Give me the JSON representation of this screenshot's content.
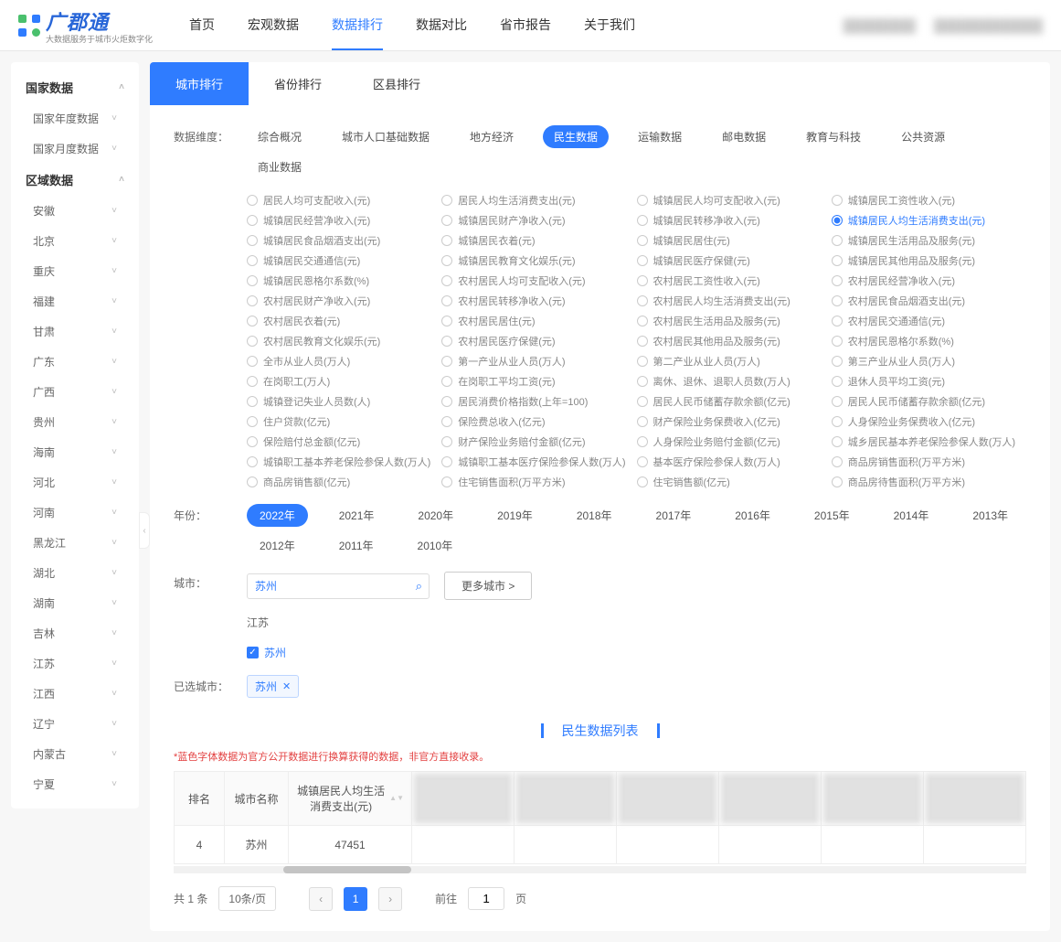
{
  "header": {
    "brand_text": "广郡通",
    "brand_sub": "大数据服务于城市火炬数字化",
    "nav": [
      "首页",
      "宏观数据",
      "数据排行",
      "数据对比",
      "省市报告",
      "关于我们"
    ],
    "nav_active": 2
  },
  "sidebar": {
    "sections": [
      {
        "title": "国家数据",
        "items": [
          "国家年度数据",
          "国家月度数据"
        ]
      },
      {
        "title": "区域数据",
        "items": [
          "安徽",
          "北京",
          "重庆",
          "福建",
          "甘肃",
          "广东",
          "广西",
          "贵州",
          "海南",
          "河北",
          "河南",
          "黑龙江",
          "湖北",
          "湖南",
          "吉林",
          "江苏",
          "江西",
          "辽宁",
          "内蒙古",
          "宁夏"
        ]
      }
    ]
  },
  "tabs": {
    "items": [
      "城市排行",
      "省份排行",
      "区县排行"
    ],
    "active": 0
  },
  "dims": {
    "label": "数据维度：",
    "items": [
      "综合概况",
      "城市人口基础数据",
      "地方经济",
      "民生数据",
      "运输数据",
      "邮电数据",
      "教育与科技",
      "公共资源",
      "商业数据"
    ],
    "active": 3
  },
  "metrics": {
    "items": [
      "居民人均可支配收入(元)",
      "居民人均生活消费支出(元)",
      "城镇居民人均可支配收入(元)",
      "城镇居民工资性收入(元)",
      "城镇居民经营净收入(元)",
      "城镇居民财产净收入(元)",
      "城镇居民转移净收入(元)",
      "城镇居民人均生活消费支出(元)",
      "城镇居民食品烟酒支出(元)",
      "城镇居民衣着(元)",
      "城镇居民居住(元)",
      "城镇居民生活用品及服务(元)",
      "城镇居民交通通信(元)",
      "城镇居民教育文化娱乐(元)",
      "城镇居民医疗保健(元)",
      "城镇居民其他用品及服务(元)",
      "城镇居民恩格尔系数(%)",
      "农村居民人均可支配收入(元)",
      "农村居民工资性收入(元)",
      "农村居民经营净收入(元)",
      "农村居民财产净收入(元)",
      "农村居民转移净收入(元)",
      "农村居民人均生活消费支出(元)",
      "农村居民食品烟酒支出(元)",
      "农村居民衣着(元)",
      "农村居民居住(元)",
      "农村居民生活用品及服务(元)",
      "农村居民交通通信(元)",
      "农村居民教育文化娱乐(元)",
      "农村居民医疗保健(元)",
      "农村居民其他用品及服务(元)",
      "农村居民恩格尔系数(%)",
      "全市从业人员(万人)",
      "第一产业从业人员(万人)",
      "第二产业从业人员(万人)",
      "第三产业从业人员(万人)",
      "在岗职工(万人)",
      "在岗职工平均工资(元)",
      "离休、退休、退职人员数(万人)",
      "退休人员平均工资(元)",
      "城镇登记失业人员数(人)",
      "居民消费价格指数(上年=100)",
      "居民人民币储蓄存款余额(亿元)",
      "居民人民币储蓄存款余额(亿元)",
      "住户贷款(亿元)",
      "保险费总收入(亿元)",
      "财产保险业务保费收入(亿元)",
      "人身保险业务保费收入(亿元)",
      "保险赔付总金额(亿元)",
      "财产保险业务赔付金额(亿元)",
      "人身保险业务赔付金额(亿元)",
      "城乡居民基本养老保险参保人数(万人)",
      "城镇职工基本养老保险参保人数(万人)",
      "城镇职工基本医疗保险参保人数(万人)",
      "基本医疗保险参保人数(万人)",
      "商品房销售面积(万平方米)",
      "商品房销售额(亿元)",
      "住宅销售面积(万平方米)",
      "住宅销售额(亿元)",
      "商品房待售面积(万平方米)"
    ],
    "checked": 7
  },
  "years": {
    "label": "年份：",
    "items": [
      "2022年",
      "2021年",
      "2020年",
      "2019年",
      "2018年",
      "2017年",
      "2016年",
      "2015年",
      "2014年",
      "2013年",
      "2012年",
      "2011年",
      "2010年"
    ],
    "active": 0
  },
  "city": {
    "label": "城市：",
    "input_value": "苏州",
    "more_btn": "更多城市 >",
    "province": "江苏",
    "checked_city": "苏州"
  },
  "selected": {
    "label": "已选城市：",
    "tag": "苏州"
  },
  "section_title": "民生数据列表",
  "note": "*蓝色字体数据为官方公开数据进行换算获得的数据，非官方直接收录。",
  "table": {
    "headers": [
      "排名",
      "城市名称",
      "城镇居民人均生活消费支出(元)"
    ],
    "row": {
      "rank": "4",
      "city": "苏州",
      "value": "47451"
    }
  },
  "pager": {
    "total_prefix": "共",
    "total_count": "1",
    "total_suffix": "条",
    "per_page": "10条/页",
    "current": "1",
    "goto_label": "前往",
    "goto_value": "1",
    "goto_suffix": "页"
  }
}
